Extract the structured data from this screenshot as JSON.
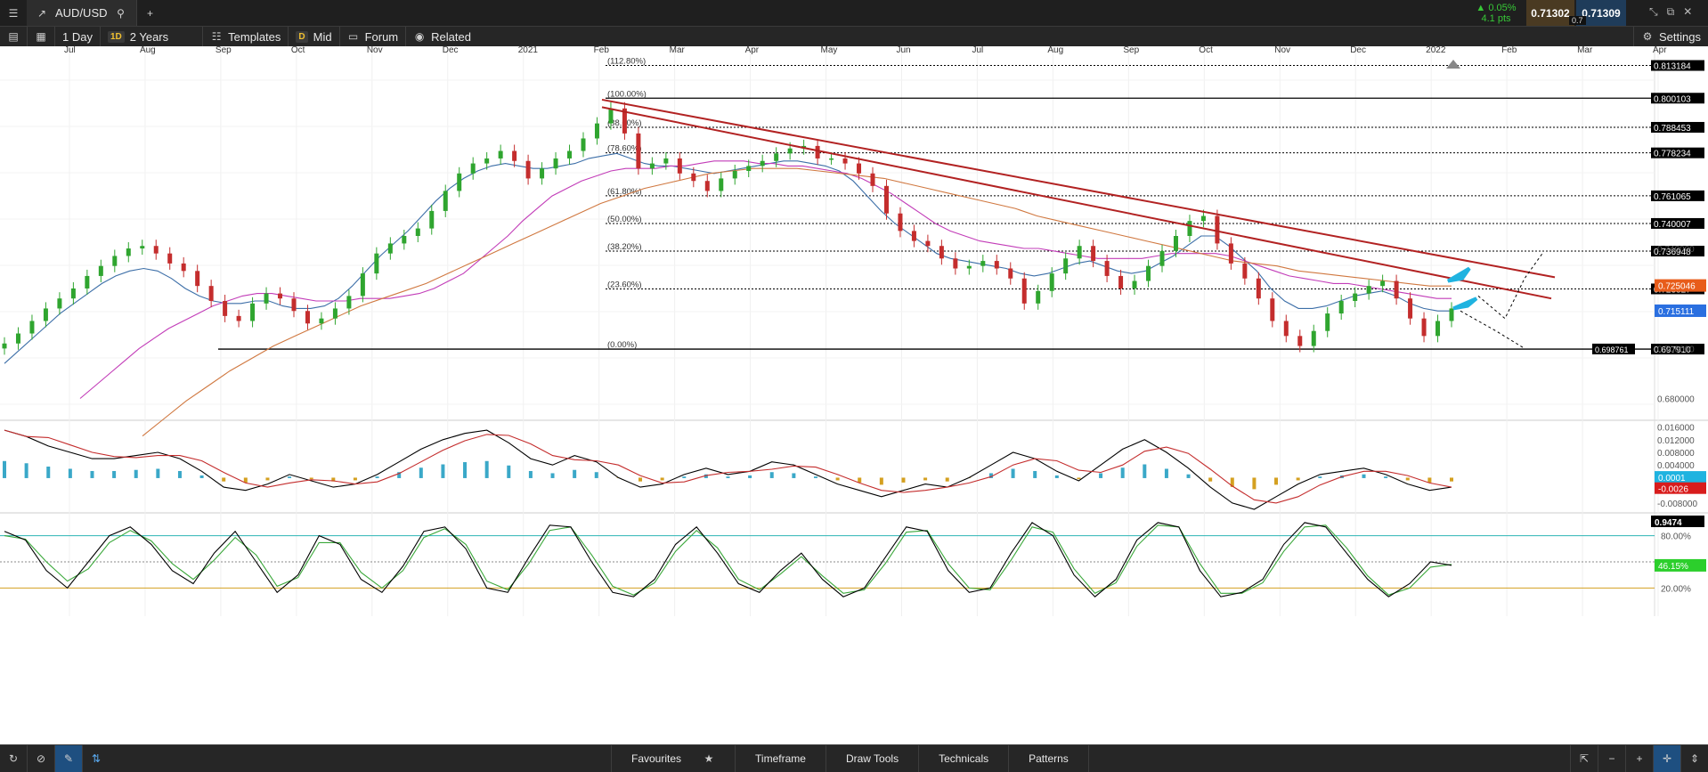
{
  "header": {
    "symbol": "AUD/USD",
    "change_pct": "▲ 0.05%",
    "change_pts": "4.1 pts",
    "bid": "0.71302",
    "spread": "0.7",
    "ask": "0.71309"
  },
  "toolbar": {
    "interval": "1 Day",
    "interval_badge": "1D",
    "range": "2 Years",
    "templates": "Templates",
    "mid_badge": "D",
    "mid": "Mid",
    "forum": "Forum",
    "related": "Related",
    "settings": "Settings"
  },
  "bottom": {
    "favourites": "Favourites",
    "timeframe": "Timeframe",
    "draw_tools": "Draw Tools",
    "technicals": "Technicals",
    "patterns": "Patterns"
  },
  "colors": {
    "up": "#2fa52f",
    "down": "#c42d2d",
    "trend": "#b22222",
    "ma_fast": "#3d6fa8",
    "ma_mid": "#c23cb8",
    "ma_slow": "#d07840",
    "cyan_arrow": "#1fb3e0"
  },
  "chart_data": {
    "type": "candlestick",
    "x_ticks": [
      "Jul",
      "Aug",
      "Sep",
      "Oct",
      "Nov",
      "Dec",
      "2021",
      "Feb",
      "Mar",
      "Apr",
      "May",
      "Jun",
      "Jul",
      "Aug",
      "Sep",
      "Oct",
      "Nov",
      "Dec",
      "2022",
      "Feb",
      "Mar",
      "Apr"
    ],
    "price_axis": {
      "range": [
        0.672,
        0.818
      ],
      "labels": [
        "0.740000",
        "0.680000",
        "0.700000"
      ]
    },
    "price_levels": [
      {
        "label": "(112.80%)",
        "value": 0.813184,
        "tag": "0.813184"
      },
      {
        "label": "(100.00%)",
        "value": 0.800103,
        "tag": "0.800103"
      },
      {
        "label": "(88.60%)",
        "value": 0.788453,
        "tag": "0.788453"
      },
      {
        "label": "(78.60%)",
        "value": 0.778234,
        "tag": "0.778234"
      },
      {
        "label": "(61.80%)",
        "value": 0.761065,
        "tag": "0.761065"
      },
      {
        "label": "(50.00%)",
        "value": 0.750007,
        "tag": "0.740007"
      },
      {
        "label": "(38.20%)",
        "value": 0.738948,
        "tag": "0.736948"
      },
      {
        "label": "(23.60%)",
        "value": 0.723827,
        "tag": "0.723827"
      },
      {
        "label": "(0.00%)",
        "value": 0.699761,
        "tag": "0.697910"
      }
    ],
    "price_tags": {
      "ma_slow": "0.725046",
      "ma_fast": "0.715111",
      "support": "0.698761"
    },
    "price_series": [
      0.702,
      0.706,
      0.711,
      0.716,
      0.72,
      0.724,
      0.729,
      0.733,
      0.737,
      0.74,
      0.741,
      0.738,
      0.734,
      0.731,
      0.725,
      0.719,
      0.713,
      0.711,
      0.718,
      0.722,
      0.72,
      0.715,
      0.71,
      0.712,
      0.716,
      0.721,
      0.73,
      0.738,
      0.742,
      0.745,
      0.748,
      0.755,
      0.763,
      0.77,
      0.774,
      0.776,
      0.779,
      0.775,
      0.768,
      0.772,
      0.776,
      0.779,
      0.784,
      0.79,
      0.796,
      0.786,
      0.772,
      0.774,
      0.776,
      0.77,
      0.767,
      0.763,
      0.768,
      0.771,
      0.773,
      0.775,
      0.778,
      0.78,
      0.781,
      0.776,
      0.776,
      0.774,
      0.77,
      0.765,
      0.754,
      0.747,
      0.743,
      0.741,
      0.736,
      0.732,
      0.733,
      0.735,
      0.732,
      0.728,
      0.718,
      0.723,
      0.73,
      0.736,
      0.741,
      0.735,
      0.729,
      0.724,
      0.727,
      0.733,
      0.739,
      0.745,
      0.751,
      0.753,
      0.742,
      0.734,
      0.728,
      0.72,
      0.711,
      0.705,
      0.701,
      0.707,
      0.714,
      0.719,
      0.722,
      0.725,
      0.727,
      0.72,
      0.712,
      0.705,
      0.711,
      0.716
    ],
    "ma_fast": [
      0.694,
      0.699,
      0.704,
      0.709,
      0.714,
      0.718,
      0.722,
      0.726,
      0.729,
      0.731,
      0.732,
      0.731,
      0.728,
      0.724,
      0.721,
      0.719,
      0.718,
      0.718,
      0.719,
      0.719,
      0.717,
      0.716,
      0.716,
      0.717,
      0.72,
      0.725,
      0.731,
      0.737,
      0.742,
      0.747,
      0.753,
      0.759,
      0.764,
      0.768,
      0.771,
      0.773,
      0.774,
      0.773,
      0.772,
      0.772,
      0.773,
      0.774,
      0.776,
      0.777,
      0.778,
      0.776,
      0.774,
      0.773,
      0.773,
      0.772,
      0.771,
      0.77,
      0.771,
      0.772,
      0.773,
      0.774,
      0.775,
      0.775,
      0.774,
      0.773,
      0.771,
      0.767,
      0.761,
      0.755,
      0.75,
      0.746,
      0.742,
      0.738,
      0.736,
      0.735,
      0.734,
      0.733,
      0.732,
      0.73,
      0.729,
      0.73,
      0.732,
      0.734,
      0.735,
      0.733,
      0.731,
      0.73,
      0.731,
      0.734,
      0.737,
      0.741,
      0.745,
      0.745,
      0.741,
      0.736,
      0.731,
      0.724,
      0.719,
      0.716,
      0.716,
      0.717,
      0.719,
      0.721,
      0.722,
      0.723,
      0.721,
      0.718,
      0.716,
      0.715,
      0.715
    ],
    "ma_mid": [
      0.68,
      0.685,
      0.69,
      0.695,
      0.7,
      0.704,
      0.708,
      0.711,
      0.714,
      0.717,
      0.719,
      0.721,
      0.722,
      0.722,
      0.721,
      0.72,
      0.719,
      0.719,
      0.719,
      0.72,
      0.72,
      0.72,
      0.721,
      0.722,
      0.724,
      0.727,
      0.73,
      0.735,
      0.74,
      0.745,
      0.751,
      0.756,
      0.761,
      0.764,
      0.767,
      0.769,
      0.771,
      0.772,
      0.772,
      0.772,
      0.773,
      0.773,
      0.774,
      0.775,
      0.775,
      0.775,
      0.774,
      0.774,
      0.773,
      0.773,
      0.772,
      0.771,
      0.77,
      0.768,
      0.765,
      0.762,
      0.758,
      0.754,
      0.75,
      0.747,
      0.745,
      0.743,
      0.742,
      0.741,
      0.74,
      0.74,
      0.739,
      0.738,
      0.737,
      0.736,
      0.736,
      0.736,
      0.736,
      0.737,
      0.738,
      0.738,
      0.738,
      0.738,
      0.737,
      0.735,
      0.733,
      0.731,
      0.729,
      0.728,
      0.727,
      0.726,
      0.726,
      0.725,
      0.724,
      0.723,
      0.722,
      0.721,
      0.72,
      0.72
    ],
    "ma_slow": [
      0.665,
      0.672,
      0.679,
      0.685,
      0.691,
      0.696,
      0.701,
      0.705,
      0.709,
      0.713,
      0.717,
      0.72,
      0.723,
      0.726,
      0.73,
      0.734,
      0.738,
      0.742,
      0.746,
      0.75,
      0.754,
      0.758,
      0.761,
      0.764,
      0.766,
      0.768,
      0.77,
      0.771,
      0.772,
      0.772,
      0.772,
      0.771,
      0.77,
      0.769,
      0.768,
      0.766,
      0.764,
      0.762,
      0.76,
      0.758,
      0.756,
      0.753,
      0.751,
      0.749,
      0.747,
      0.745,
      0.743,
      0.741,
      0.739,
      0.737,
      0.735,
      0.734,
      0.733,
      0.731,
      0.73,
      0.729,
      0.728,
      0.727,
      0.726,
      0.725,
      0.725
    ],
    "macd": {
      "axis_labels": [
        "0.016000",
        "0.012000",
        "0.008000",
        "0.004000",
        "0.000000",
        "-0.008000"
      ],
      "tags": [
        "0.0001",
        "-0.0026"
      ],
      "range": [
        -0.01,
        0.017
      ],
      "line": [
        0.015,
        0.013,
        0.01,
        0.008,
        0.006,
        0.006,
        0.007,
        0.008,
        0.006,
        0.002,
        -0.003,
        -0.004,
        -0.002,
        0.001,
        -0.001,
        -0.003,
        -0.002,
        0.001,
        0.005,
        0.009,
        0.012,
        0.014,
        0.015,
        0.011,
        0.006,
        0.004,
        0.007,
        0.005,
        0.0,
        -0.003,
        -0.002,
        0.001,
        0.003,
        0.001,
        0.002,
        0.005,
        0.004,
        0.001,
        -0.002,
        -0.004,
        -0.006,
        -0.004,
        -0.002,
        -0.003,
        0.0,
        0.004,
        0.008,
        0.006,
        0.002,
        -0.001,
        0.004,
        0.009,
        0.012,
        0.008,
        0.003,
        -0.003,
        -0.008,
        -0.01,
        -0.006,
        -0.002,
        0.001,
        0.002,
        0.003,
        0.001,
        -0.002,
        -0.004,
        -0.003
      ]
    },
    "stochastic": {
      "axis_labels": [
        "80.00%",
        "20.00%"
      ],
      "top_tag": "0.9474",
      "tag": "46.15%",
      "range": [
        0,
        100
      ],
      "k": [
        85,
        75,
        40,
        20,
        50,
        80,
        90,
        70,
        40,
        25,
        60,
        85,
        50,
        15,
        35,
        80,
        70,
        30,
        15,
        45,
        85,
        90,
        65,
        20,
        15,
        55,
        92,
        90,
        50,
        15,
        10,
        30,
        70,
        90,
        60,
        25,
        15,
        40,
        60,
        30,
        10,
        20,
        55,
        90,
        85,
        40,
        15,
        20,
        60,
        95,
        80,
        35,
        10,
        30,
        75,
        95,
        90,
        40,
        10,
        15,
        30,
        70,
        95,
        90,
        60,
        30,
        10,
        25,
        50,
        46
      ],
      "d": [
        80,
        76,
        50,
        28,
        42,
        72,
        86,
        74,
        48,
        30,
        52,
        78,
        58,
        22,
        32,
        72,
        72,
        38,
        20,
        40,
        78,
        88,
        70,
        28,
        18,
        48,
        86,
        90,
        58,
        22,
        12,
        26,
        62,
        86,
        66,
        30,
        18,
        36,
        56,
        34,
        14,
        18,
        48,
        84,
        86,
        48,
        20,
        18,
        52,
        90,
        84,
        42,
        14,
        26,
        68,
        92,
        90,
        48,
        14,
        14,
        26,
        62,
        90,
        92,
        66,
        34,
        12,
        20,
        44,
        47
      ],
      "levels": [
        80,
        50,
        20
      ]
    }
  }
}
